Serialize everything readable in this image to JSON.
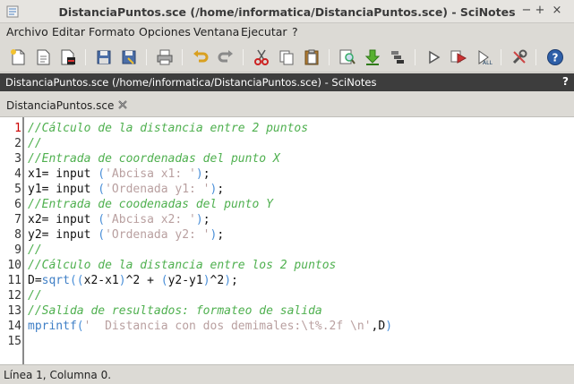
{
  "window": {
    "title": "DistanciaPuntos.sce (/home/informatica/DistanciaPuntos.sce) - SciNotes",
    "controls": [
      "−",
      "+",
      "×"
    ]
  },
  "menu": [
    "Archivo",
    "Editar",
    "Formato",
    "Opciones",
    "Ventana",
    "Ejecutar",
    "?"
  ],
  "toolbar_icons": [
    "new-file-icon",
    "open-file-icon",
    "open-recent-icon",
    "save-icon",
    "save-as-icon",
    "print-icon",
    "undo-icon",
    "redo-icon",
    "cut-icon",
    "copy-icon",
    "paste-icon",
    "find-replace-icon",
    "load-into-scilab-icon",
    "execute-file-icon",
    "run-icon",
    "run-with-echo-icon",
    "run-step-icon",
    "preferences-icon",
    "help-icon"
  ],
  "document_bar": {
    "title": "DistanciaPuntos.sce (/home/informatica/DistanciaPuntos.sce) - SciNotes",
    "help": "?"
  },
  "tab": {
    "label": "DistanciaPuntos.sce"
  },
  "editor": {
    "current_line": 1,
    "line_numbers": [
      "1",
      "2",
      "3",
      "4",
      "5",
      "6",
      "7",
      "8",
      "9",
      "10",
      "11",
      "12",
      "13",
      "14",
      "15"
    ],
    "lines": [
      [
        {
          "t": "//Cálculo de la distancia entre 2 puntos",
          "c": "com"
        }
      ],
      [
        {
          "t": "//",
          "c": "com"
        }
      ],
      [
        {
          "t": "//Entrada de coordenadas del punto X",
          "c": "com"
        }
      ],
      [
        {
          "t": "x1= input ",
          "c": "plain"
        },
        {
          "t": "(",
          "c": "par"
        },
        {
          "t": "'Abcisa x1: '",
          "c": "str"
        },
        {
          "t": ")",
          "c": "par"
        },
        {
          "t": ";",
          "c": "plain"
        }
      ],
      [
        {
          "t": "y1= input ",
          "c": "plain"
        },
        {
          "t": "(",
          "c": "par"
        },
        {
          "t": "'Ordenada y1: '",
          "c": "str"
        },
        {
          "t": ")",
          "c": "par"
        },
        {
          "t": ";",
          "c": "plain"
        }
      ],
      [
        {
          "t": "//Entrada de coodenadas del punto Y",
          "c": "com"
        }
      ],
      [
        {
          "t": "x2= input ",
          "c": "plain"
        },
        {
          "t": "(",
          "c": "par"
        },
        {
          "t": "'Abcisa x2: '",
          "c": "str"
        },
        {
          "t": ")",
          "c": "par"
        },
        {
          "t": ";",
          "c": "plain"
        }
      ],
      [
        {
          "t": "y2= input ",
          "c": "plain"
        },
        {
          "t": "(",
          "c": "par"
        },
        {
          "t": "'Ordenada y2: '",
          "c": "str"
        },
        {
          "t": ")",
          "c": "par"
        },
        {
          "t": ";",
          "c": "plain"
        }
      ],
      [
        {
          "t": "//",
          "c": "com"
        }
      ],
      [
        {
          "t": "//Cálculo de la distancia entre los 2 puntos",
          "c": "com"
        }
      ],
      [
        {
          "t": "D=",
          "c": "plain"
        },
        {
          "t": "sqrt",
          "c": "fn"
        },
        {
          "t": "((",
          "c": "par"
        },
        {
          "t": "x2-x1",
          "c": "plain"
        },
        {
          "t": ")",
          "c": "par"
        },
        {
          "t": "^2 + ",
          "c": "plain"
        },
        {
          "t": "(",
          "c": "par"
        },
        {
          "t": "y2-y1",
          "c": "plain"
        },
        {
          "t": ")",
          "c": "par"
        },
        {
          "t": "^2",
          "c": "plain"
        },
        {
          "t": ")",
          "c": "par"
        },
        {
          "t": ";",
          "c": "plain"
        }
      ],
      [
        {
          "t": "//",
          "c": "com"
        }
      ],
      [
        {
          "t": "//Salida de resultados: formateo de salida",
          "c": "com"
        }
      ],
      [
        {
          "t": "mprintf",
          "c": "fn"
        },
        {
          "t": "(",
          "c": "par"
        },
        {
          "t": "'  Distancia con dos demimales:\\t%.2f \\n'",
          "c": "str"
        },
        {
          "t": ",D",
          "c": "plain"
        },
        {
          "t": ")",
          "c": "par"
        }
      ],
      []
    ]
  },
  "status": {
    "text": "Línea 1, Columna 0."
  },
  "colors": {
    "comment": "#4fb04f",
    "string": "#b9a0a0",
    "paren": "#4a8fd8",
    "function": "#3f7fc6",
    "doc_bar": "#3d3d3d",
    "current_line_number": "#cc0000"
  }
}
